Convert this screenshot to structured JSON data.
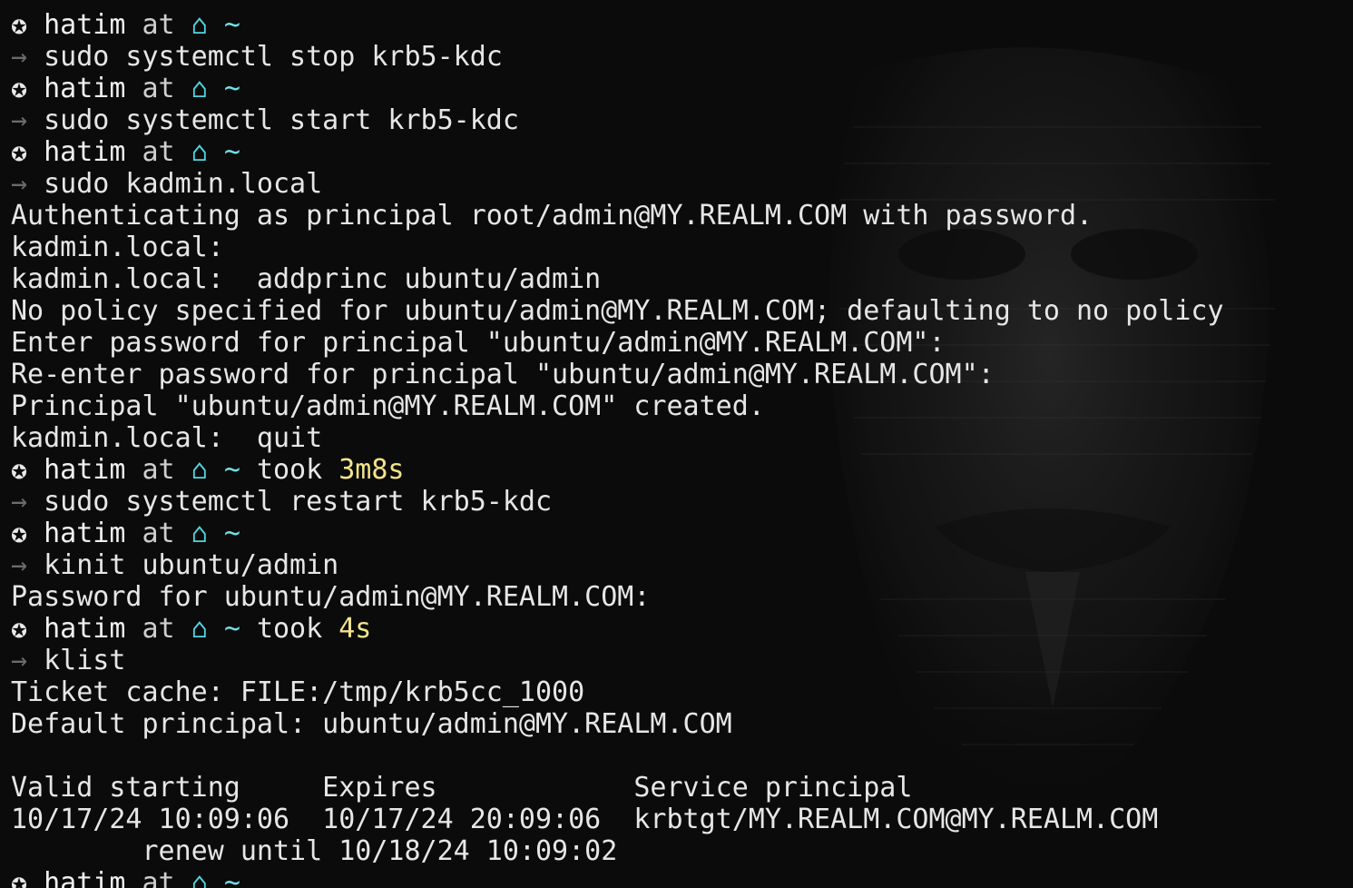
{
  "prompt": {
    "status_glyph": "✪",
    "arrow": "→",
    "user": "hatim",
    "at": "at",
    "home_glyph": "⌂",
    "cwd": "~",
    "took_label": "took"
  },
  "colors": {
    "background": "#0b0b0b",
    "text": "#e8e8e8",
    "arrow": "#6b6b6b",
    "home_icon": "#4fd6e0",
    "duration": "#f3e48a"
  },
  "lines": [
    {
      "type": "prompt",
      "took": ""
    },
    {
      "type": "command",
      "text": "sudo systemctl stop krb5-kdc"
    },
    {
      "type": "prompt",
      "took": ""
    },
    {
      "type": "command",
      "text": "sudo systemctl start krb5-kdc"
    },
    {
      "type": "prompt",
      "took": ""
    },
    {
      "type": "command",
      "text": "sudo kadmin.local"
    },
    {
      "type": "output",
      "text": "Authenticating as principal root/admin@MY.REALM.COM with password."
    },
    {
      "type": "output",
      "text": "kadmin.local:"
    },
    {
      "type": "output",
      "text": "kadmin.local:  addprinc ubuntu/admin"
    },
    {
      "type": "output",
      "text": "No policy specified for ubuntu/admin@MY.REALM.COM; defaulting to no policy"
    },
    {
      "type": "output",
      "text": "Enter password for principal \"ubuntu/admin@MY.REALM.COM\":"
    },
    {
      "type": "output",
      "text": "Re-enter password for principal \"ubuntu/admin@MY.REALM.COM\":"
    },
    {
      "type": "output",
      "text": "Principal \"ubuntu/admin@MY.REALM.COM\" created."
    },
    {
      "type": "output",
      "text": "kadmin.local:  quit"
    },
    {
      "type": "prompt",
      "took": "3m8s"
    },
    {
      "type": "command",
      "text": "sudo systemctl restart krb5-kdc"
    },
    {
      "type": "prompt",
      "took": ""
    },
    {
      "type": "command",
      "text": "kinit ubuntu/admin"
    },
    {
      "type": "output",
      "text": "Password for ubuntu/admin@MY.REALM.COM:"
    },
    {
      "type": "prompt",
      "took": "4s"
    },
    {
      "type": "command",
      "text": "klist"
    },
    {
      "type": "output",
      "text": "Ticket cache: FILE:/tmp/krb5cc_1000"
    },
    {
      "type": "output",
      "text": "Default principal: ubuntu/admin@MY.REALM.COM"
    },
    {
      "type": "output",
      "text": ""
    },
    {
      "type": "output",
      "text": "Valid starting     Expires            Service principal"
    },
    {
      "type": "output",
      "text": "10/17/24 10:09:06  10/17/24 20:09:06  krbtgt/MY.REALM.COM@MY.REALM.COM"
    },
    {
      "type": "output",
      "text": "        renew until 10/18/24 10:09:02"
    },
    {
      "type": "prompt",
      "took": ""
    }
  ]
}
